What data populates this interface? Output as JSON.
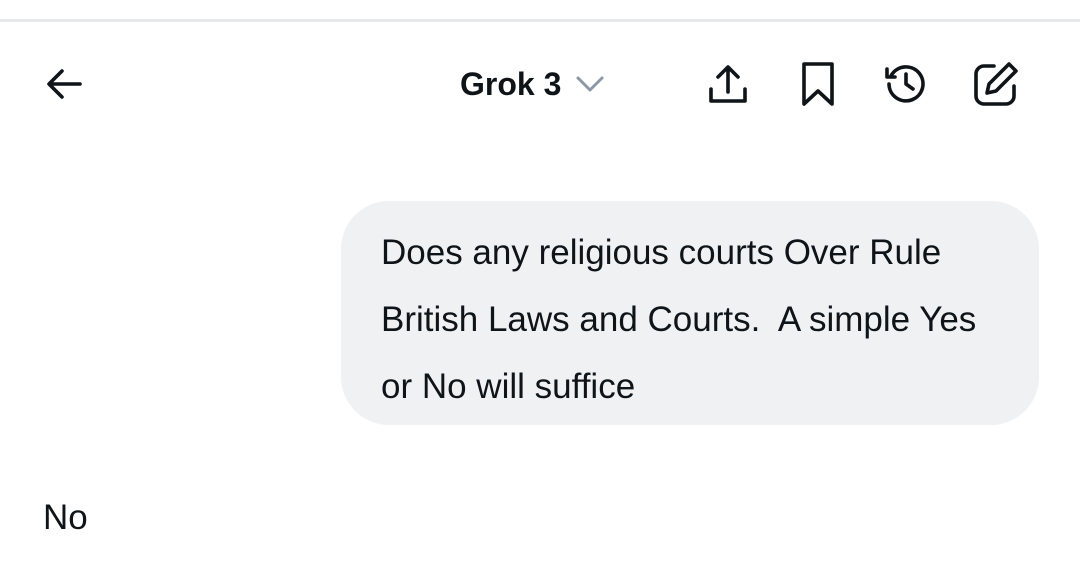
{
  "header": {
    "model_name": "Grok 3",
    "icons": {
      "back": "arrow-left-icon",
      "model_dropdown": "chevron-down-icon",
      "share": "share-upload-icon",
      "bookmark": "bookmark-icon",
      "history": "history-icon",
      "new_chat": "edit-compose-icon"
    }
  },
  "conversation": {
    "user_message": "Does any religious courts Over Rule British Laws and Courts.  A simple Yes or No will suffice",
    "assistant_message": "No"
  },
  "colors": {
    "text": "#0f1419",
    "bubble_background": "#eff1f2",
    "chevron": "#8b98a5",
    "divider": "#e6e8ea"
  }
}
